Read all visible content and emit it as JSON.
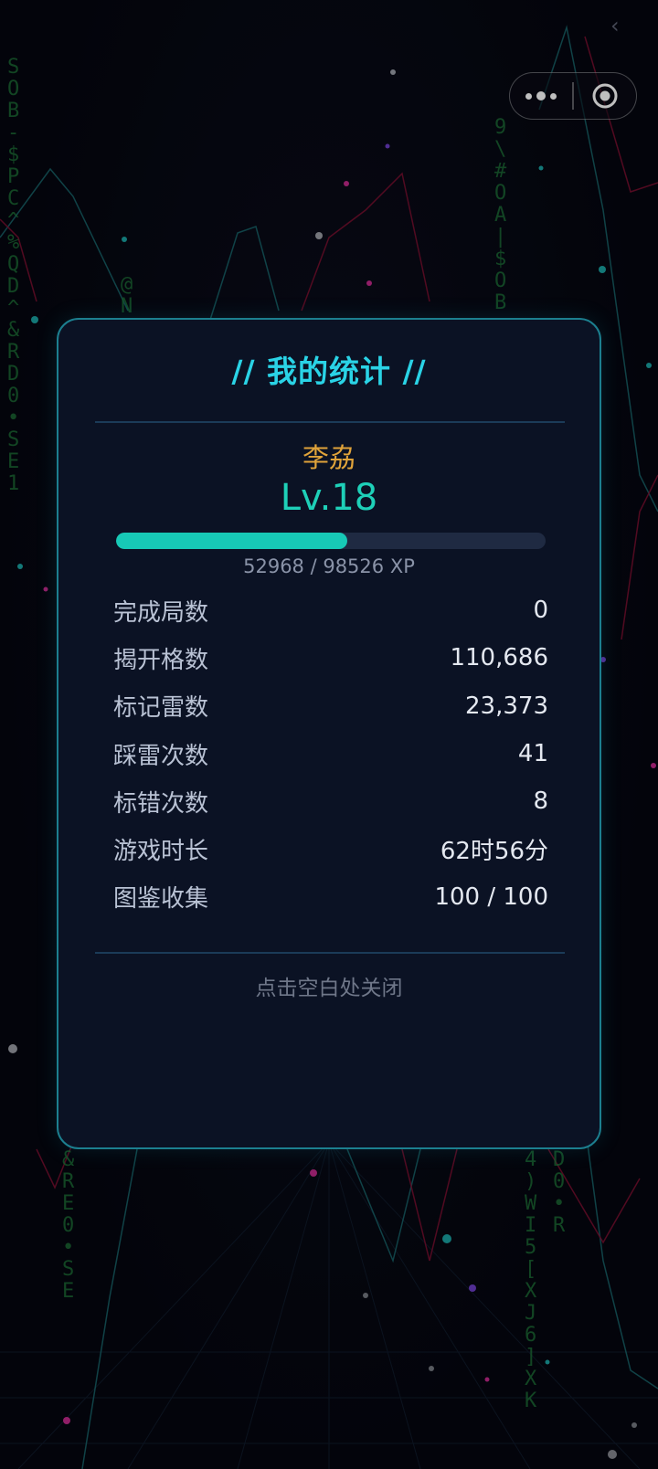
{
  "capsule": {
    "more_icon": "more-dots-icon",
    "close_icon": "target-circle-icon"
  },
  "background": {
    "matrix_columns": [
      {
        "chars": [
          "S",
          "O",
          "B",
          "-",
          "$",
          "P",
          "C",
          "^",
          "%",
          "Q",
          "D",
          "^",
          "&",
          "R",
          "D",
          "0",
          "•",
          "S",
          "E",
          "1"
        ]
      },
      {
        "chars": [
          "@",
          "N"
        ]
      },
      {
        "chars": [
          "9",
          "\\",
          "#",
          "O",
          "A",
          "|",
          "$",
          "O",
          "B"
        ]
      },
      {
        "chars": [
          "&",
          "R",
          "E",
          "0",
          "•",
          "S",
          "E"
        ]
      },
      {
        "chars": [
          "4",
          ")",
          "W",
          "I",
          "5",
          "[",
          "X",
          "J",
          "6",
          "]",
          "X",
          "K"
        ]
      },
      {
        "chars": [
          "D",
          "0",
          "•",
          "R"
        ]
      }
    ],
    "colors": {
      "matrix": "#1f7a3a",
      "line_teal": "#1a6e73",
      "line_red": "#7a1030",
      "grid": "#0f1a2a"
    }
  },
  "stats": {
    "title": "// 我的统计 //",
    "player_name": "李劦",
    "level": "Lv.18",
    "xp_current": 52968,
    "xp_total": 98526,
    "xp_text": "52968 / 98526 XP",
    "rows": [
      {
        "label": "完成局数",
        "value": "0"
      },
      {
        "label": "揭开格数",
        "value": "110,686"
      },
      {
        "label": "标记雷数",
        "value": "23,373"
      },
      {
        "label": "踩雷次数",
        "value": "41"
      },
      {
        "label": "标错次数",
        "value": "8"
      },
      {
        "label": "游戏时长",
        "value": "62时56分"
      },
      {
        "label": "图鉴收集",
        "value": "100 / 100"
      }
    ],
    "close_hint": "点击空白处关闭"
  },
  "theme": {
    "accent": "#2ad3e6",
    "name_color": "#e0a33a",
    "level_color": "#1ed0b8",
    "card_border": "#1c7f8f",
    "card_bg": "#0b1224"
  }
}
